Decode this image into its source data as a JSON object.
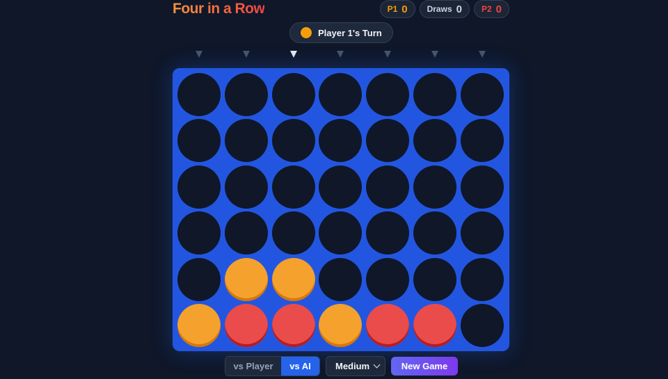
{
  "title": "Four in a Row",
  "scores": {
    "p1_label": "P1",
    "p1_value": "0",
    "draws_label": "Draws",
    "draws_value": "0",
    "p2_label": "P2",
    "p2_value": "0"
  },
  "turn": {
    "text": "Player 1's Turn",
    "current_player": 1
  },
  "colors": {
    "p1": "#f4a12e",
    "p2": "#ea4b4b",
    "board": "#2356e0",
    "empty": "#0f1729"
  },
  "hover_column": 2,
  "board": {
    "columns": 7,
    "rows": 6,
    "cells": [
      [
        0,
        0,
        0,
        0,
        0,
        0,
        0
      ],
      [
        0,
        0,
        0,
        0,
        0,
        0,
        0
      ],
      [
        0,
        0,
        0,
        0,
        0,
        0,
        0
      ],
      [
        0,
        0,
        0,
        0,
        0,
        0,
        0
      ],
      [
        0,
        1,
        1,
        0,
        0,
        0,
        0
      ],
      [
        1,
        2,
        2,
        1,
        2,
        2,
        0
      ]
    ]
  },
  "controls": {
    "mode_player": "vs Player",
    "mode_ai": "vs AI",
    "selected_mode": "vs AI",
    "difficulty": "Medium",
    "new_game": "New Game"
  }
}
